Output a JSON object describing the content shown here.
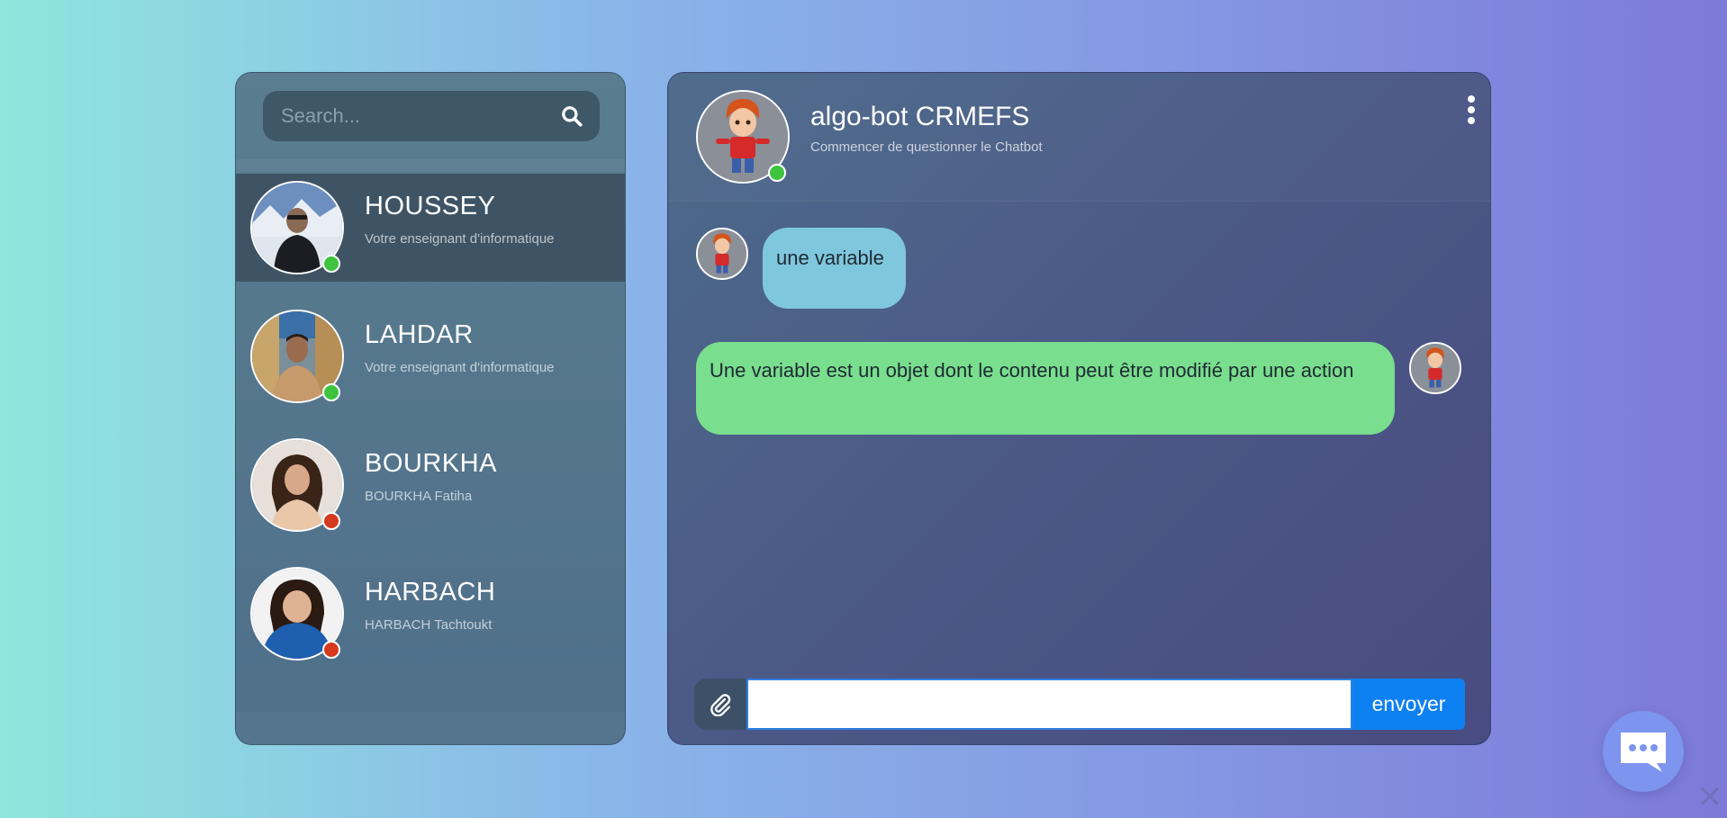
{
  "search": {
    "placeholder": "Search..."
  },
  "contacts": [
    {
      "name": "HOUSSEY",
      "subtitle": "Votre enseignant d'informatique",
      "status": "online",
      "active": true
    },
    {
      "name": "LAHDAR",
      "subtitle": "Votre enseignant d'informatique",
      "status": "online",
      "active": false
    },
    {
      "name": "BOURKHA",
      "subtitle": "BOURKHA Fatiha",
      "status": "offline",
      "active": false
    },
    {
      "name": "HARBACH",
      "subtitle": "HARBACH Tachtoukt",
      "status": "offline",
      "active": false
    }
  ],
  "chat": {
    "title": "algo-bot CRMEFS",
    "subtitle": "Commencer de questionner le Chatbot",
    "messages": [
      {
        "from": "user",
        "text": "une variable"
      },
      {
        "from": "bot",
        "text": "Une variable est un objet dont le contenu peut être modifié par une action"
      }
    ]
  },
  "composer": {
    "value": "",
    "send_label": "envoyer"
  },
  "colors": {
    "online": "#3ec43e",
    "offline": "#d63a1e",
    "user_bubble": "#7fc7dd",
    "bot_bubble": "#79de8e",
    "send_button": "#0d80f2"
  },
  "icons": {
    "search": "search-icon",
    "menu": "more-vertical-icon",
    "attach": "paperclip-icon",
    "launcher": "chat-bubble-icon",
    "close": "close-icon"
  }
}
